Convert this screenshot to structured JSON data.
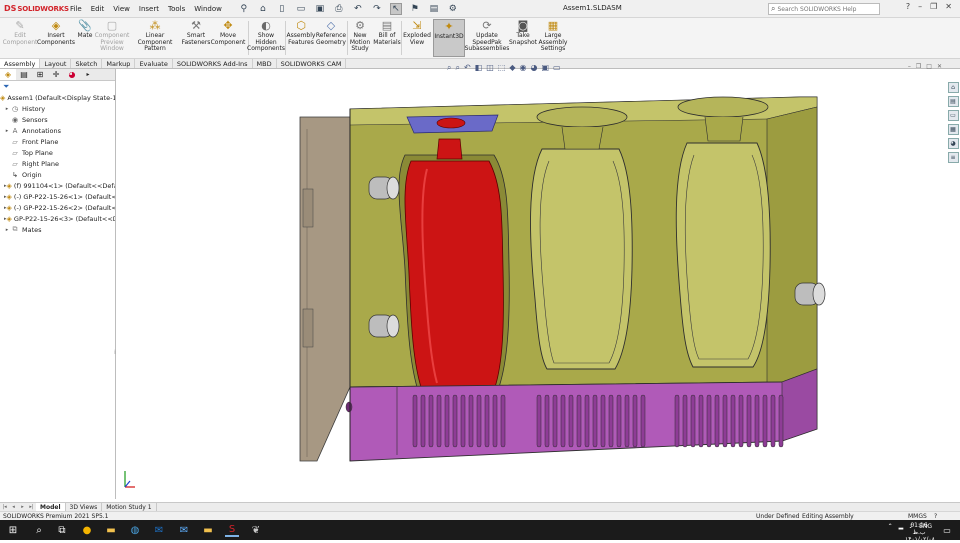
{
  "titlebar": {
    "logo_prefix": "DS",
    "brand": "SOLIDWORKS",
    "menus": [
      "File",
      "Edit",
      "View",
      "Insert",
      "Tools",
      "Window"
    ],
    "document_title": "Assem1.SLDASM",
    "help_search_placeholder": "Search SOLIDWORKS Help",
    "window_controls": [
      "?",
      "–",
      "❐",
      "✕"
    ]
  },
  "ribbon": {
    "buttons": [
      {
        "label": "Edit\nComponent",
        "icon": "edit-component-icon",
        "enabled": false
      },
      {
        "label": "Insert\nComponents",
        "icon": "insert-components-icon",
        "enabled": true
      },
      {
        "label": "Mate",
        "icon": "mate-icon",
        "enabled": true
      },
      {
        "label": "Component\nPreview\nWindow",
        "icon": "component-preview-icon",
        "enabled": false
      },
      {
        "label": "Linear Component\nPattern",
        "icon": "linear-pattern-icon",
        "enabled": true
      },
      {
        "label": "Smart\nFasteners",
        "icon": "smart-fasteners-icon",
        "enabled": true
      },
      {
        "label": "Move\nComponent",
        "icon": "move-component-icon",
        "enabled": true
      },
      {
        "label": "Show\nHidden\nComponents",
        "icon": "show-hidden-icon",
        "enabled": true
      },
      {
        "label": "Assembly\nFeatures",
        "icon": "assembly-features-icon",
        "enabled": true
      },
      {
        "label": "Reference\nGeometry",
        "icon": "reference-geometry-icon",
        "enabled": true
      },
      {
        "label": "New\nMotion\nStudy",
        "icon": "motion-study-icon",
        "enabled": true
      },
      {
        "label": "Bill of\nMaterials",
        "icon": "bom-icon",
        "enabled": true
      },
      {
        "label": "Exploded\nView",
        "icon": "exploded-view-icon",
        "enabled": true
      },
      {
        "label": "Instant3D",
        "icon": "instant3d-icon",
        "enabled": true,
        "active": true
      },
      {
        "label": "Update\nSpeedPak\nSubassemblies",
        "icon": "speedpak-icon",
        "enabled": true
      },
      {
        "label": "Take\nSnapshot",
        "icon": "snapshot-icon",
        "enabled": true
      },
      {
        "label": "Large\nAssembly\nSettings",
        "icon": "large-assembly-icon",
        "enabled": true
      }
    ]
  },
  "tabs": [
    "Assembly",
    "Layout",
    "Sketch",
    "Markup",
    "Evaluate",
    "SOLIDWORKS Add-Ins",
    "MBD",
    "SOLIDWORKS CAM"
  ],
  "feature_tree": {
    "items": [
      {
        "label": "Assem1  (Default<Display State-1>)",
        "icon": "assembly-icon",
        "expander": ""
      },
      {
        "label": "History",
        "icon": "history-icon",
        "expander": "▸"
      },
      {
        "label": "Sensors",
        "icon": "sensors-icon",
        "expander": ""
      },
      {
        "label": "Annotations",
        "icon": "annotations-icon",
        "expander": "▸"
      },
      {
        "label": "Front Plane",
        "icon": "plane-icon",
        "expander": ""
      },
      {
        "label": "Top Plane",
        "icon": "plane-icon",
        "expander": ""
      },
      {
        "label": "Right Plane",
        "icon": "plane-icon",
        "expander": ""
      },
      {
        "label": "Origin",
        "icon": "origin-icon",
        "expander": ""
      },
      {
        "label": "(f) 991104<1> (Default<<Default>",
        "icon": "part-icon",
        "expander": "▸"
      },
      {
        "label": "(-) GP-P22-15-26<1> (Default<<D",
        "icon": "part-icon",
        "expander": "▸"
      },
      {
        "label": "(-) GP-P22-15-26<2> (Default<<D",
        "icon": "part-icon",
        "expander": "▸"
      },
      {
        "label": "GP-P22-15-26<3> (Default<<Defa",
        "icon": "part-icon",
        "expander": "▸"
      },
      {
        "label": "Mates",
        "icon": "mates-icon",
        "expander": "▸"
      }
    ]
  },
  "bottom_tabs": [
    "Model",
    "3D Views",
    "Motion Study 1"
  ],
  "status": {
    "product": "SOLIDWORKS Premium 2021 SP5.1",
    "state": "Under Defined",
    "mode": "Editing Assembly",
    "units": "MMGS"
  },
  "taskbar": {
    "language": "ENG",
    "time": "01:16 ب.ظ",
    "date": "۱۴۰۱/۰۲/۰۸"
  },
  "colors": {
    "mold_body": "#a9a94a",
    "mold_base": "#b05ab8",
    "bottle": "#cc1414",
    "neck_insert": "#6a6ac8",
    "side_plate": "#a79883"
  }
}
